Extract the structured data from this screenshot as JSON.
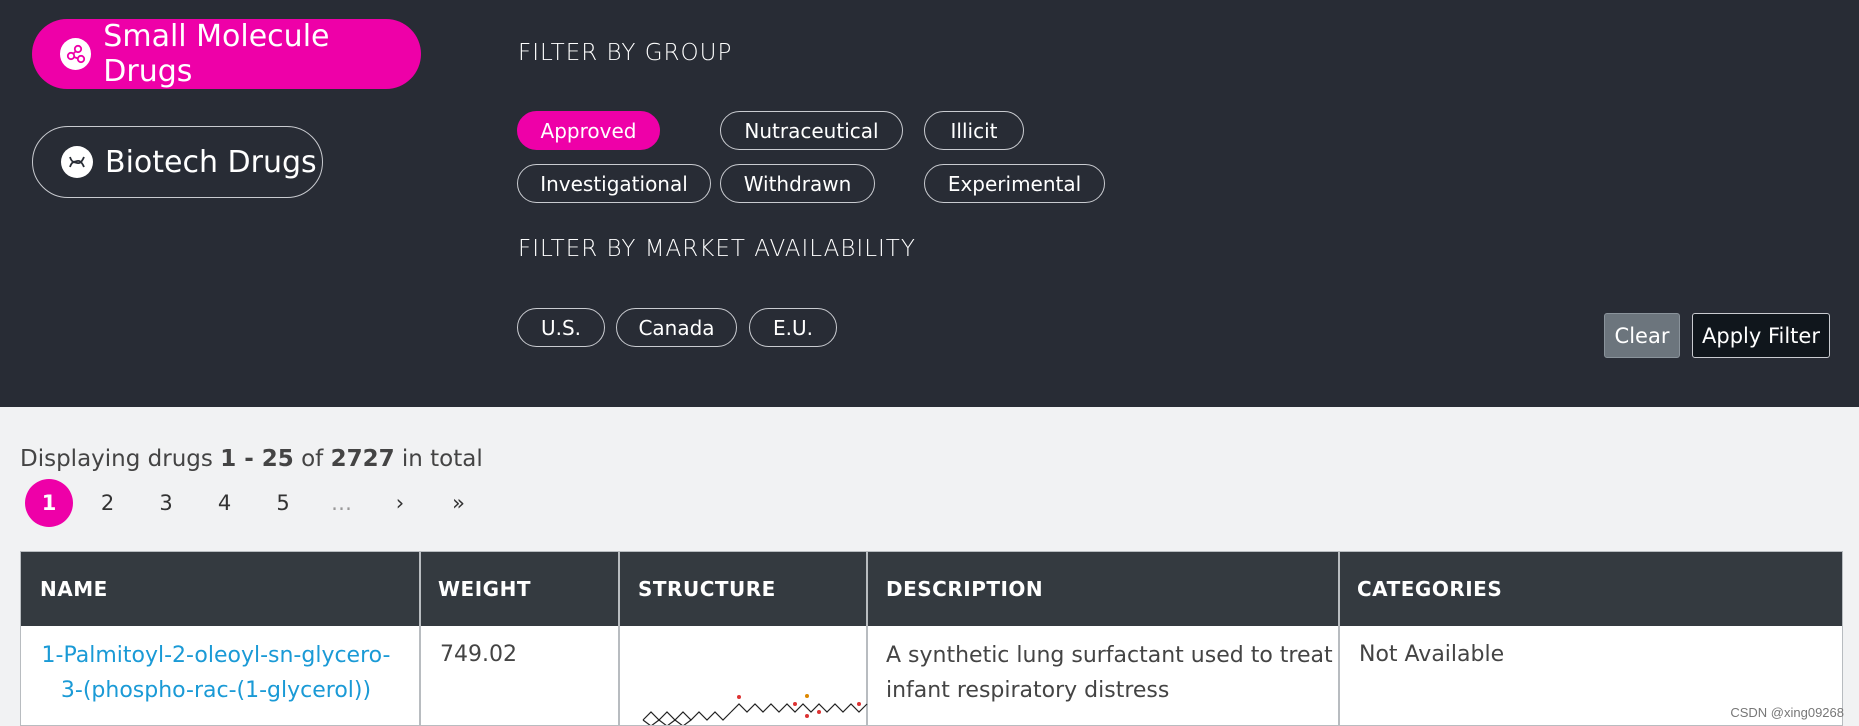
{
  "drug_types": {
    "small_molecule": "Small Molecule Drugs",
    "biotech": "Biotech Drugs"
  },
  "filters": {
    "group_title": "FILTER BY GROUP",
    "groups": {
      "approved": "Approved",
      "nutraceutical": "Nutraceutical",
      "illicit": "Illicit",
      "investigational": "Investigational",
      "withdrawn": "Withdrawn",
      "experimental": "Experimental"
    },
    "market_title": "FILTER BY MARKET AVAILABILITY",
    "markets": {
      "us": "U.S.",
      "canada": "Canada",
      "eu": "E.U."
    },
    "clear_label": "Clear",
    "apply_label": "Apply Filter"
  },
  "results": {
    "prefix": "Displaying drugs",
    "range": "1 - 25",
    "of": "of",
    "total": "2727",
    "suffix": "in total"
  },
  "pagination": {
    "pages": [
      "1",
      "2",
      "3",
      "4",
      "5"
    ],
    "ellipsis": "…",
    "next": "›",
    "last": "»",
    "current": "1"
  },
  "table": {
    "headers": {
      "name": "NAME",
      "weight": "WEIGHT",
      "structure": "STRUCTURE",
      "description": "DESCRIPTION",
      "categories": "CATEGORIES"
    },
    "rows": [
      {
        "name": "1-Palmitoyl-2-oleoyl-sn-glycero-3-(phospho-rac-(1-glycerol))",
        "weight": "749.02",
        "description": "A synthetic lung surfactant used to treat infant respiratory distress",
        "categories": "Not Available"
      }
    ]
  },
  "watermark": "CSDN @xing09268",
  "colors": {
    "header_bg": "#282c35",
    "accent": "#ee00a8",
    "link": "#1a9ad6",
    "table_header_bg": "#343a40",
    "page_bg": "#f1f2f3"
  },
  "icons": {
    "small_molecule": "molecule-icon",
    "biotech": "dna-icon"
  }
}
